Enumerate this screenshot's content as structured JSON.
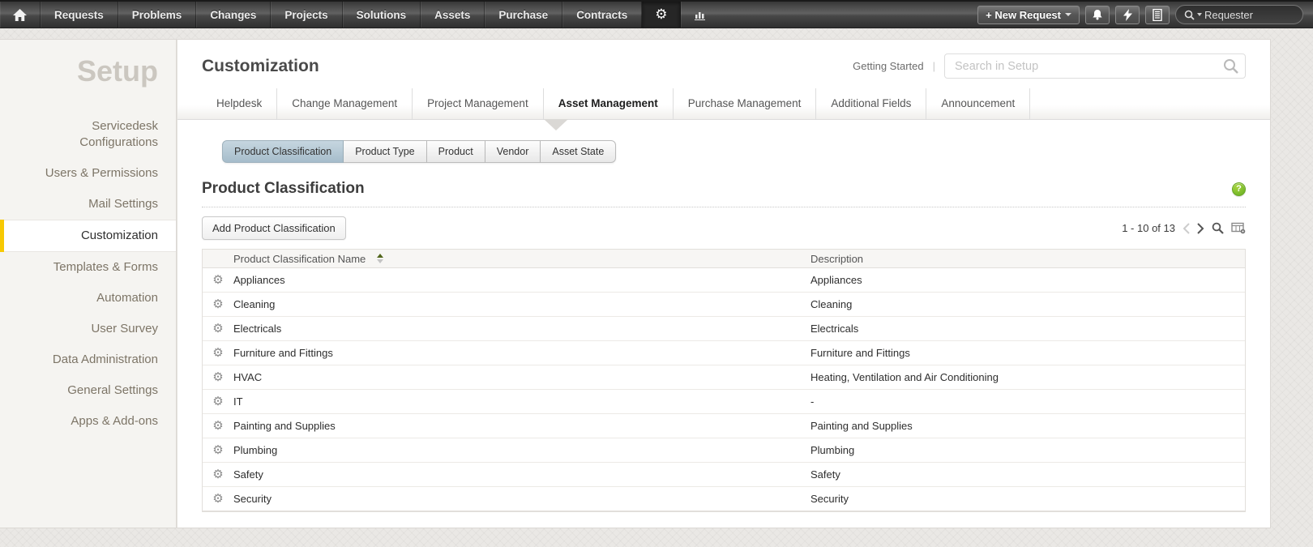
{
  "topnav": {
    "items": [
      "Requests",
      "Problems",
      "Changes",
      "Projects",
      "Solutions",
      "Assets",
      "Purchase",
      "Contracts"
    ],
    "new_request_label": "+ New Request",
    "search_scope_placeholder": "Requester",
    "icons": [
      "home-icon",
      "gear-icon",
      "reports-bar-chart-icon",
      "bell-icon",
      "lightning-icon",
      "tasks-list-icon",
      "search-icon"
    ]
  },
  "sidebar": {
    "title": "Setup",
    "items": [
      "Servicedesk Configurations",
      "Users & Permissions",
      "Mail Settings",
      "Customization",
      "Templates & Forms",
      "Automation",
      "User Survey",
      "Data Administration",
      "General Settings",
      "Apps & Add-ons"
    ],
    "active_item": "Customization"
  },
  "header": {
    "title": "Customization",
    "getting_started": "Getting Started",
    "pipe": "|",
    "search_placeholder": "Search in Setup"
  },
  "tabs": [
    "Helpdesk",
    "Change Management",
    "Project Management",
    "Asset Management",
    "Purchase Management",
    "Additional Fields",
    "Announcement"
  ],
  "active_tab": "Asset Management",
  "subtabs": [
    "Product Classification",
    "Product Type",
    "Product",
    "Vendor",
    "Asset State"
  ],
  "active_subtab": "Product Classification",
  "section": {
    "title": "Product Classification",
    "add_button": "Add Product Classification",
    "pagination": "1 - 10 of 13"
  },
  "table": {
    "columns": [
      "Product Classification Name",
      "Description"
    ],
    "sort": {
      "column": "Product Classification Name",
      "direction": "asc"
    },
    "rows": [
      {
        "name": "Appliances",
        "description": "Appliances"
      },
      {
        "name": "Cleaning",
        "description": "Cleaning"
      },
      {
        "name": "Electricals",
        "description": "Electricals"
      },
      {
        "name": "Furniture and Fittings",
        "description": "Furniture and Fittings"
      },
      {
        "name": "HVAC",
        "description": "Heating, Ventilation and Air Conditioning"
      },
      {
        "name": "IT",
        "description": "-"
      },
      {
        "name": "Painting and Supplies",
        "description": "Painting and Supplies"
      },
      {
        "name": "Plumbing",
        "description": "Plumbing"
      },
      {
        "name": "Safety",
        "description": "Safety"
      },
      {
        "name": "Security",
        "description": "Security"
      }
    ],
    "row_gear_glyph": "⚙"
  },
  "colors": {
    "accent_yellow": "#f7c903",
    "help_green": "#76b82a",
    "subtab_selected_blue": "#b7cbd7",
    "topbar_dark": "#3a3a3a"
  }
}
